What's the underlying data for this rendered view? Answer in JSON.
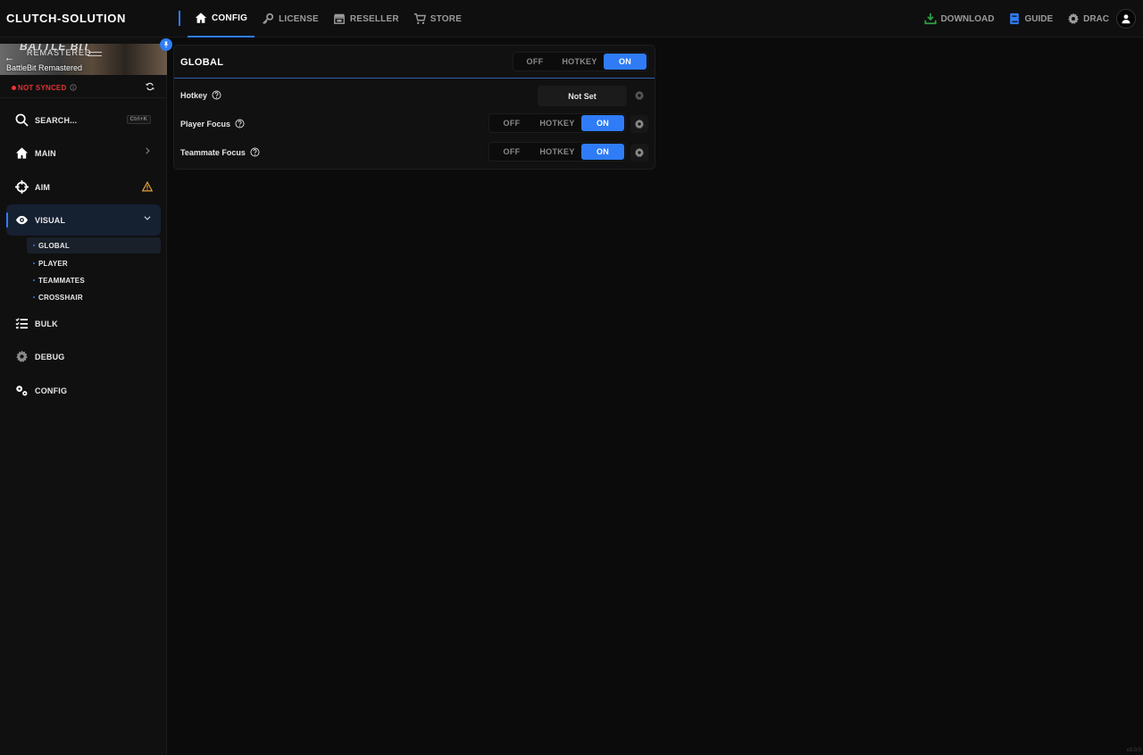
{
  "app": {
    "brand": "CLUTCH-SOLUTION",
    "version": "v3.0.0"
  },
  "topnav": {
    "items": [
      {
        "label": "CONFIG",
        "icon": "home-icon",
        "active": true
      },
      {
        "label": "LICENSE",
        "icon": "key-icon",
        "active": false
      },
      {
        "label": "RESELLER",
        "icon": "store-icon",
        "active": false
      },
      {
        "label": "STORE",
        "icon": "cart-icon",
        "active": false
      }
    ],
    "right": {
      "download": "DOWNLOAD",
      "guide": "GUIDE",
      "user": "DRAC"
    }
  },
  "sidebar": {
    "game": {
      "logo": "BATTLE BIT",
      "logo_sub": "REMASTERED",
      "name": "BattleBit Remastered"
    },
    "sync_status": "NOT SYNCED",
    "search": {
      "label": "SEARCH...",
      "shortcut": "Ctrl+K"
    },
    "items": [
      {
        "label": "MAIN",
        "icon": "home-icon"
      },
      {
        "label": "AIM",
        "icon": "crosshair-icon"
      },
      {
        "label": "VISUAL",
        "icon": "eye-icon"
      },
      {
        "label": "BULK",
        "icon": "checklist-icon"
      },
      {
        "label": "DEBUG",
        "icon": "gear-icon"
      },
      {
        "label": "CONFIG",
        "icon": "gears-icon"
      }
    ],
    "visual_sub": [
      {
        "label": "GLOBAL",
        "active": true
      },
      {
        "label": "PLAYER",
        "active": false
      },
      {
        "label": "TEAMMATES",
        "active": false
      },
      {
        "label": "CROSSHAIR",
        "active": false
      }
    ]
  },
  "panel": {
    "title": "GLOBAL",
    "mode_options": [
      "OFF",
      "HOTKEY",
      "ON"
    ],
    "mode_selected": "ON",
    "rows": [
      {
        "label": "Hotkey",
        "value": "Not Set"
      },
      {
        "label": "Player Focus",
        "options": [
          "OFF",
          "HOTKEY",
          "ON"
        ],
        "selected": "ON"
      },
      {
        "label": "Teammate Focus",
        "options": [
          "OFF",
          "HOTKEY",
          "ON"
        ],
        "selected": "ON"
      }
    ]
  },
  "colors": {
    "accent": "#2f7cf6",
    "warning": "#e6a23c",
    "error": "#dd3333",
    "download": "#2ea043"
  }
}
